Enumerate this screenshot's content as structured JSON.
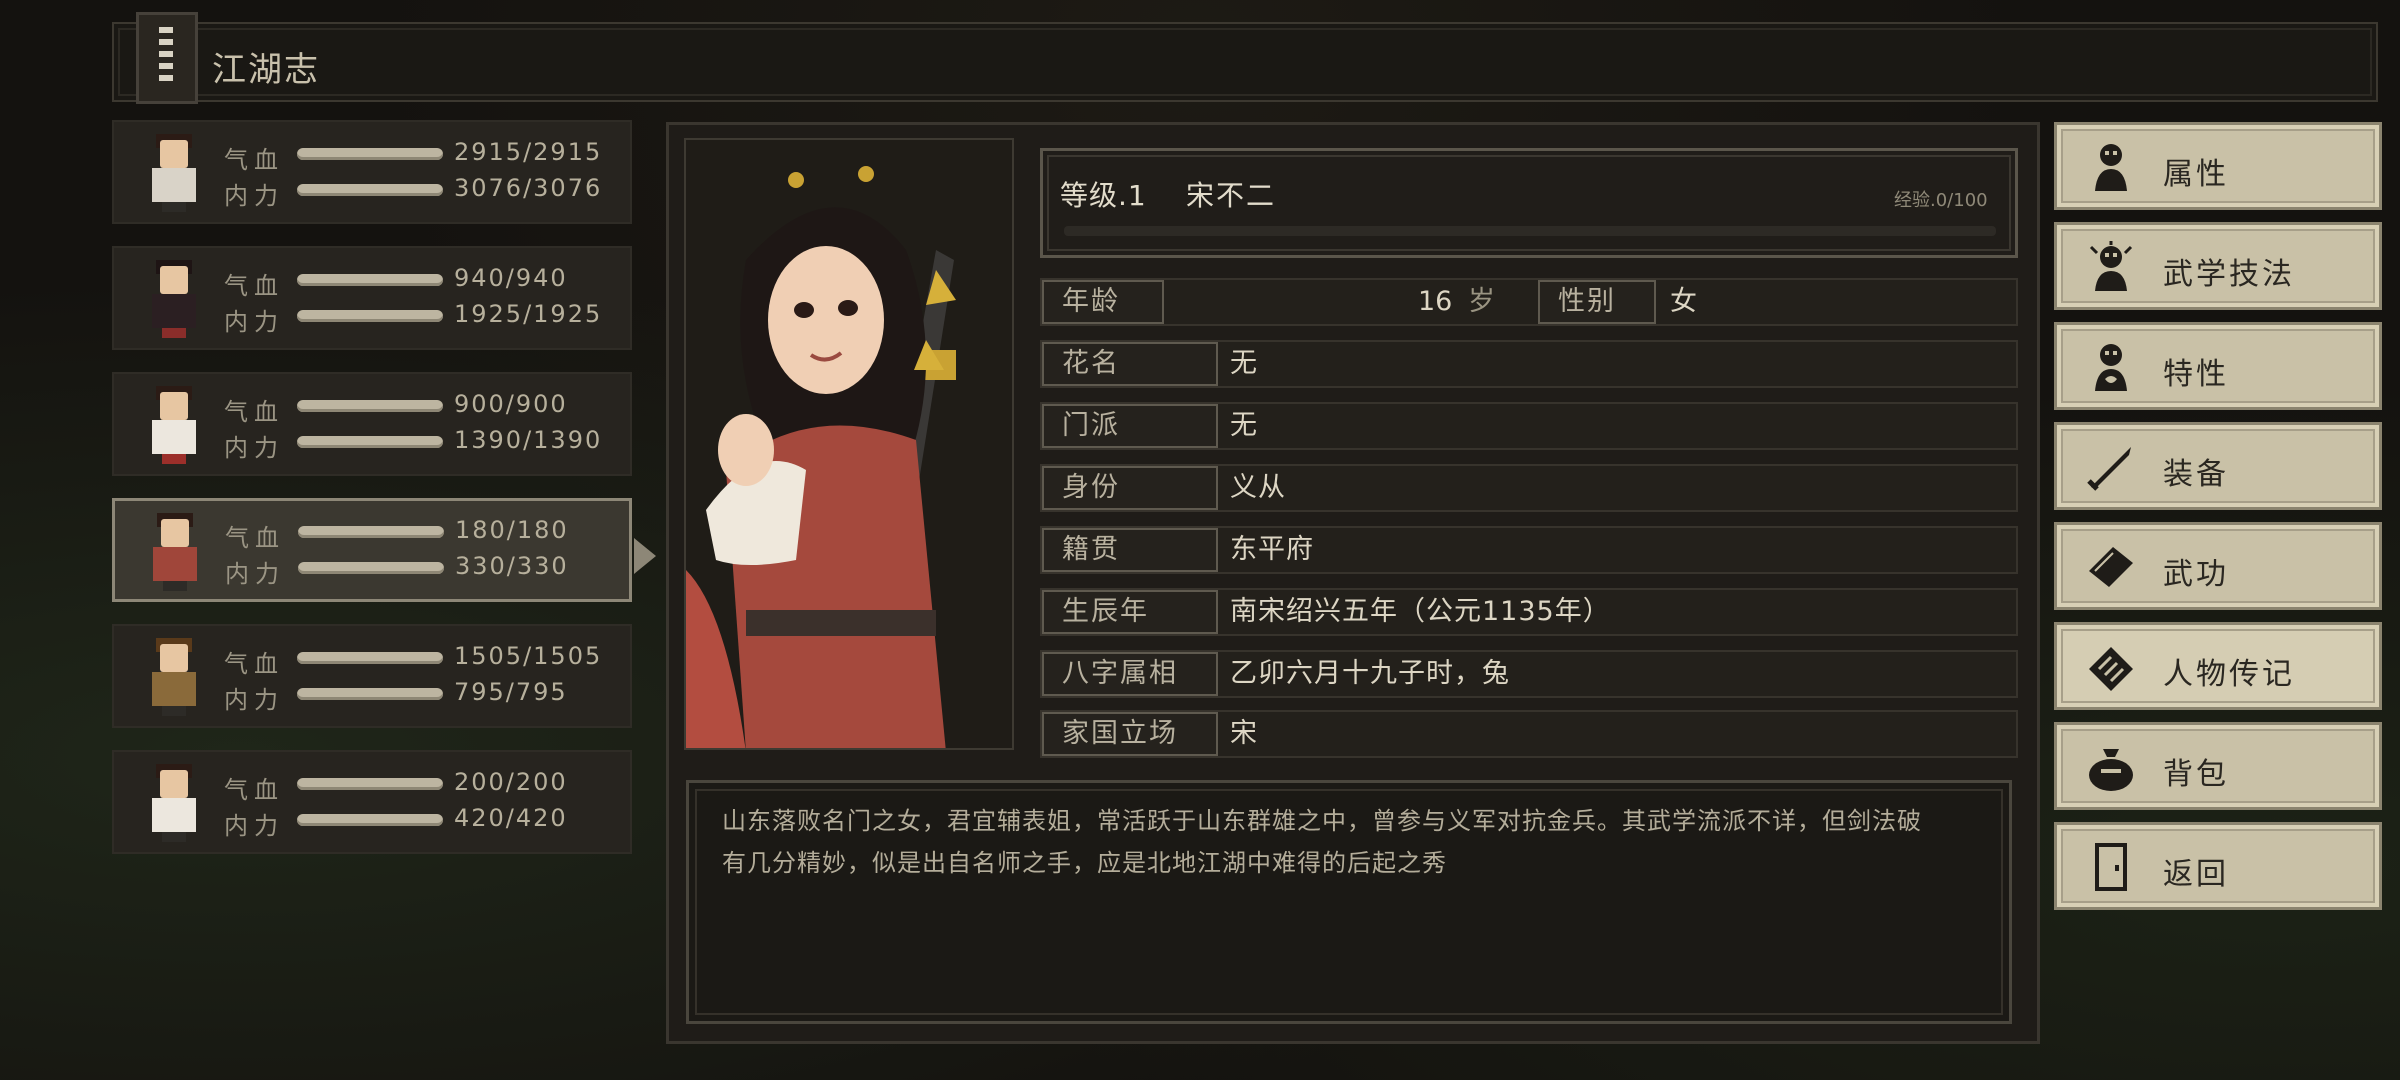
{
  "header": {
    "title": "江湖志"
  },
  "party": [
    {
      "hp_label": "气血",
      "mp_label": "内力",
      "hp": "2915/2915",
      "mp": "3076/3076",
      "hp_fill": 1.0,
      "mp_fill": 1.0
    },
    {
      "hp_label": "气血",
      "mp_label": "内力",
      "hp": "940/940",
      "mp": "1925/1925",
      "hp_fill": 1.0,
      "mp_fill": 1.0
    },
    {
      "hp_label": "气血",
      "mp_label": "内力",
      "hp": "900/900",
      "mp": "1390/1390",
      "hp_fill": 1.0,
      "mp_fill": 1.0
    },
    {
      "hp_label": "气血",
      "mp_label": "内力",
      "hp": "180/180",
      "mp": "330/330",
      "hp_fill": 1.0,
      "mp_fill": 1.0,
      "selected": true
    },
    {
      "hp_label": "气血",
      "mp_label": "内力",
      "hp": "1505/1505",
      "mp": "795/795",
      "hp_fill": 1.0,
      "mp_fill": 1.0
    },
    {
      "hp_label": "气血",
      "mp_label": "内力",
      "hp": "200/200",
      "mp": "420/420",
      "hp_fill": 1.0,
      "mp_fill": 1.0
    }
  ],
  "character": {
    "level": "等级.1",
    "name": "宋不二",
    "exp": "经验.0/100",
    "exp_fill": 0.0,
    "age_label": "年龄",
    "age": "16",
    "age_unit": "岁",
    "gender_label": "性别",
    "gender": "女",
    "fields": [
      {
        "label": "花名",
        "value": "无"
      },
      {
        "label": "门派",
        "value": "无"
      },
      {
        "label": "身份",
        "value": "义从"
      },
      {
        "label": "籍贯",
        "value": "东平府"
      },
      {
        "label": "生辰年",
        "value": "南宋绍兴五年（公元1135年）"
      },
      {
        "label": "八字属相",
        "value": "乙卯六月十九子时，兔"
      },
      {
        "label": "家国立场",
        "value": "宋"
      }
    ],
    "bio_line1": "山东落败名门之女，君宜辅表姐，常活跃于山东群雄之中，曾参与义军对抗金兵。其武学流派不详，但剑法破",
    "bio_line2": "有几分精妙，似是出自名师之手，应是北地江湖中难得的后起之秀"
  },
  "menu": [
    {
      "label": "属性",
      "icon": "person-icon"
    },
    {
      "label": "武学技法",
      "icon": "skill-person-icon"
    },
    {
      "label": "特性",
      "icon": "trait-person-icon"
    },
    {
      "label": "装备",
      "icon": "sword-icon"
    },
    {
      "label": "武功",
      "icon": "manual-book-icon"
    },
    {
      "label": "人物传记",
      "icon": "scroll-icon",
      "active": true
    },
    {
      "label": "背包",
      "icon": "bag-icon"
    },
    {
      "label": "返回",
      "icon": "door-icon"
    }
  ],
  "colors": {
    "panel": "#1f1c18",
    "menu_button": "#c9c1a7",
    "bar": "#bdb5a1",
    "text": "#ddd6c4"
  }
}
